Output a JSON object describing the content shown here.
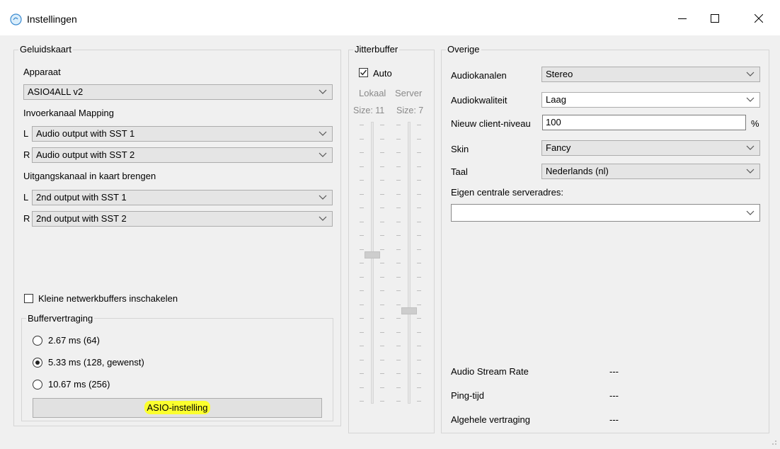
{
  "window": {
    "title": "Instellingen",
    "minimize_icon": "minimize-icon",
    "maximize_icon": "maximize-icon",
    "close_icon": "close-icon"
  },
  "soundcard": {
    "title": "Geluidskaart",
    "device_label": "Apparaat",
    "device_value": "ASIO4ALL v2",
    "input_mapping_label": "Invoerkanaal Mapping",
    "input_l_prefix": "L",
    "input_l_value": "Audio output with SST 1",
    "input_r_prefix": "R",
    "input_r_value": "Audio output with SST 2",
    "output_mapping_label": "Uitgangskanaal in kaart brengen",
    "output_l_prefix": "L",
    "output_l_value": "2nd output with SST 1",
    "output_r_prefix": "R",
    "output_r_value": "2nd output with SST 2",
    "small_buffers_label": "Kleine netwerkbuffers inschakelen",
    "small_buffers_checked": false
  },
  "buffer_delay": {
    "title": "Buffervertraging",
    "options": [
      {
        "label": "2.67 ms (64)",
        "selected": false
      },
      {
        "label": "5.33 ms (128, gewenst)",
        "selected": true
      },
      {
        "label": "10.67 ms (256)",
        "selected": false
      }
    ],
    "asio_button": "ASIO-instelling"
  },
  "jitter": {
    "title": "Jitterbuffer",
    "auto_label": "Auto",
    "auto_checked": true,
    "local_label": "Lokaal",
    "server_label": "Server",
    "local_size": "Size: 11",
    "server_size": "Size: 7"
  },
  "other": {
    "title": "Overige",
    "audio_channels_label": "Audiokanalen",
    "audio_channels_value": "Stereo",
    "audio_quality_label": "Audiokwaliteit",
    "audio_quality_value": "Laag",
    "new_client_label": "Nieuw client-niveau",
    "new_client_value": "100",
    "new_client_unit": "%",
    "skin_label": "Skin",
    "skin_value": "Fancy",
    "language_label": "Taal",
    "language_value": "Nederlands (nl)",
    "central_server_label": "Eigen centrale serveradres:",
    "central_server_value": "",
    "stream_rate_label": "Audio Stream Rate",
    "stream_rate_value": "---",
    "ping_label": "Ping-tijd",
    "ping_value": "---",
    "total_delay_label": "Algehele vertraging",
    "total_delay_value": "---"
  }
}
